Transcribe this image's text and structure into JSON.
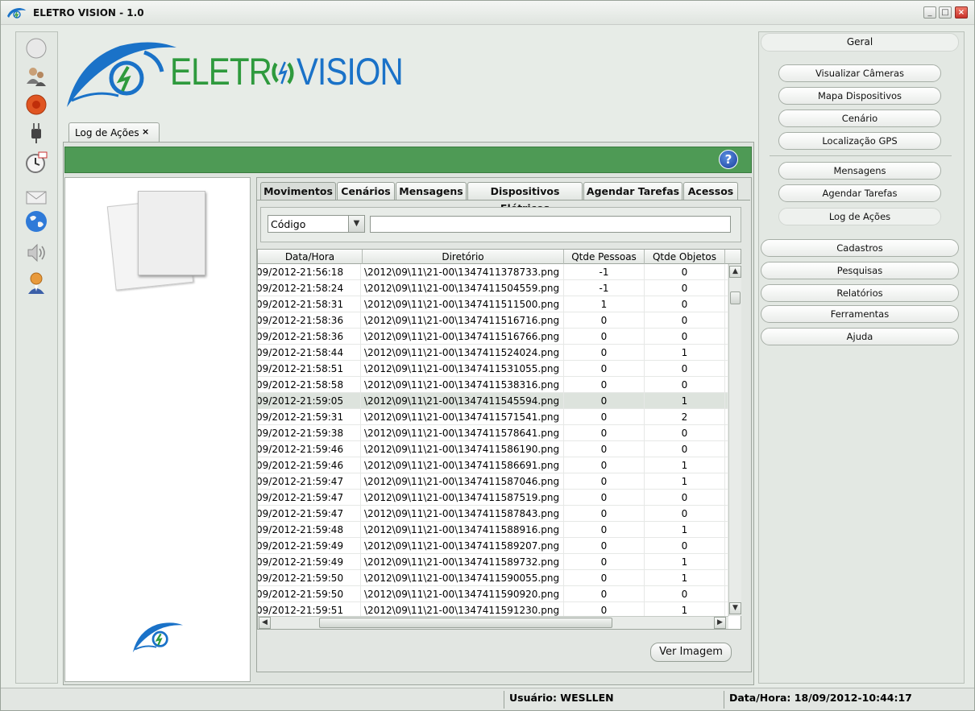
{
  "window": {
    "title": "ELETRO VISION - 1.0",
    "min_glyph": "_",
    "max_glyph": "□",
    "close_glyph": "×"
  },
  "logo": {
    "part1": "ELETR",
    "part2": "VISION"
  },
  "left_toolbar": {
    "icons": [
      "circle-icon",
      "users-icon",
      "record-icon",
      "plug-icon",
      "clock-icon",
      "mail-icon",
      "globe-icon",
      "speaker-icon",
      "operator-icon"
    ]
  },
  "doc_tab": {
    "label": "Log de Ações",
    "close": "×"
  },
  "help": {
    "label": "?"
  },
  "tabs": [
    {
      "label": "Movimentos",
      "active": true
    },
    {
      "label": "Cenários"
    },
    {
      "label": "Mensagens"
    },
    {
      "label": "Dispositivos Elétricos"
    },
    {
      "label": "Agendar Tarefas"
    },
    {
      "label": "Acessos"
    }
  ],
  "filter": {
    "field": "Código",
    "value": ""
  },
  "table": {
    "columns": [
      "Data/Hora",
      "Diretório",
      "Qtde Pessoas",
      "Qtde Objetos"
    ],
    "rows": [
      [
        "09/2012-21:56:18",
        "\\2012\\09\\11\\21-00\\1347411378733.png",
        "-1",
        "0"
      ],
      [
        "09/2012-21:58:24",
        "\\2012\\09\\11\\21-00\\1347411504559.png",
        "-1",
        "0"
      ],
      [
        "09/2012-21:58:31",
        "\\2012\\09\\11\\21-00\\1347411511500.png",
        "1",
        "0"
      ],
      [
        "09/2012-21:58:36",
        "\\2012\\09\\11\\21-00\\1347411516716.png",
        "0",
        "0"
      ],
      [
        "09/2012-21:58:36",
        "\\2012\\09\\11\\21-00\\1347411516766.png",
        "0",
        "0"
      ],
      [
        "09/2012-21:58:44",
        "\\2012\\09\\11\\21-00\\1347411524024.png",
        "0",
        "1"
      ],
      [
        "09/2012-21:58:51",
        "\\2012\\09\\11\\21-00\\1347411531055.png",
        "0",
        "0"
      ],
      [
        "09/2012-21:58:58",
        "\\2012\\09\\11\\21-00\\1347411538316.png",
        "0",
        "0"
      ],
      [
        "09/2012-21:59:05",
        "\\2012\\09\\11\\21-00\\1347411545594.png",
        "0",
        "1"
      ],
      [
        "09/2012-21:59:31",
        "\\2012\\09\\11\\21-00\\1347411571541.png",
        "0",
        "2"
      ],
      [
        "09/2012-21:59:38",
        "\\2012\\09\\11\\21-00\\1347411578641.png",
        "0",
        "0"
      ],
      [
        "09/2012-21:59:46",
        "\\2012\\09\\11\\21-00\\1347411586190.png",
        "0",
        "0"
      ],
      [
        "09/2012-21:59:46",
        "\\2012\\09\\11\\21-00\\1347411586691.png",
        "0",
        "1"
      ],
      [
        "09/2012-21:59:47",
        "\\2012\\09\\11\\21-00\\1347411587046.png",
        "0",
        "1"
      ],
      [
        "09/2012-21:59:47",
        "\\2012\\09\\11\\21-00\\1347411587519.png",
        "0",
        "0"
      ],
      [
        "09/2012-21:59:47",
        "\\2012\\09\\11\\21-00\\1347411587843.png",
        "0",
        "0"
      ],
      [
        "09/2012-21:59:48",
        "\\2012\\09\\11\\21-00\\1347411588916.png",
        "0",
        "1"
      ],
      [
        "09/2012-21:59:49",
        "\\2012\\09\\11\\21-00\\1347411589207.png",
        "0",
        "0"
      ],
      [
        "09/2012-21:59:49",
        "\\2012\\09\\11\\21-00\\1347411589732.png",
        "0",
        "1"
      ],
      [
        "09/2012-21:59:50",
        "\\2012\\09\\11\\21-00\\1347411590055.png",
        "0",
        "1"
      ],
      [
        "09/2012-21:59:50",
        "\\2012\\09\\11\\21-00\\1347411590920.png",
        "0",
        "0"
      ],
      [
        "09/2012-21:59:51",
        "\\2012\\09\\11\\21-00\\1347411591230.png",
        "0",
        "1"
      ]
    ],
    "selected_row": 8
  },
  "ver_imagem": "Ver Imagem",
  "right_nav": {
    "geral": "Geral",
    "group1": [
      "Visualizar Câmeras",
      "Mapa Dispositivos",
      "Cenário",
      "Localização GPS"
    ],
    "group2": [
      "Mensagens",
      "Agendar Tarefas",
      "Log de Ações"
    ],
    "group3": [
      "Cadastros",
      "Pesquisas",
      "Relatórios",
      "Ferramentas",
      "Ajuda"
    ]
  },
  "status": {
    "user": "Usuário: WESLLEN",
    "datetime": "Data/Hora: 18/09/2012-10:44:17"
  },
  "colors": {
    "green_bar": "#4e9a55",
    "logo_green": "#2e9a3d",
    "logo_blue": "#1a72c8"
  }
}
